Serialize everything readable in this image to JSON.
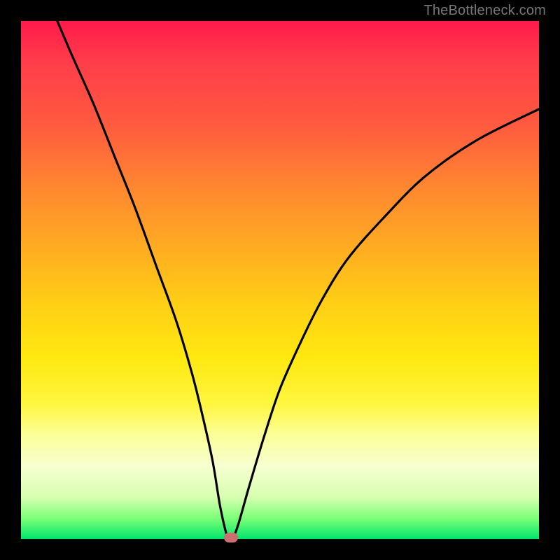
{
  "watermark": "TheBottleneck.com",
  "colors": {
    "background": "#000000",
    "curve": "#000000",
    "marker": "#cc6f6e"
  },
  "chart_data": {
    "type": "line",
    "title": "",
    "xlabel": "",
    "ylabel": "",
    "xlim": [
      0,
      100
    ],
    "ylim": [
      0,
      100
    ],
    "grid": false,
    "legend": false,
    "series": [
      {
        "name": "bottleneck-curve",
        "x": [
          7,
          10,
          14,
          18,
          22,
          26,
          30,
          33,
          35,
          37,
          38.5,
          40,
          41,
          42,
          44,
          47,
          50,
          54,
          58,
          63,
          70,
          78,
          88,
          100
        ],
        "y": [
          100,
          93,
          84,
          74,
          64,
          53,
          42,
          32,
          24,
          15,
          6,
          0,
          0.5,
          3,
          10,
          20,
          29,
          38,
          46,
          54,
          62,
          70,
          77,
          83
        ]
      }
    ],
    "marker": {
      "x": 40.5,
      "y": 0,
      "shape": "rounded-rect"
    },
    "gradient_stops": [
      {
        "pct": 0,
        "color": "#ff1a4a"
      },
      {
        "pct": 33,
        "color": "#ff8a2f"
      },
      {
        "pct": 65,
        "color": "#ffe810"
      },
      {
        "pct": 86,
        "color": "#f7ffd0"
      },
      {
        "pct": 100,
        "color": "#00e56a"
      }
    ]
  }
}
